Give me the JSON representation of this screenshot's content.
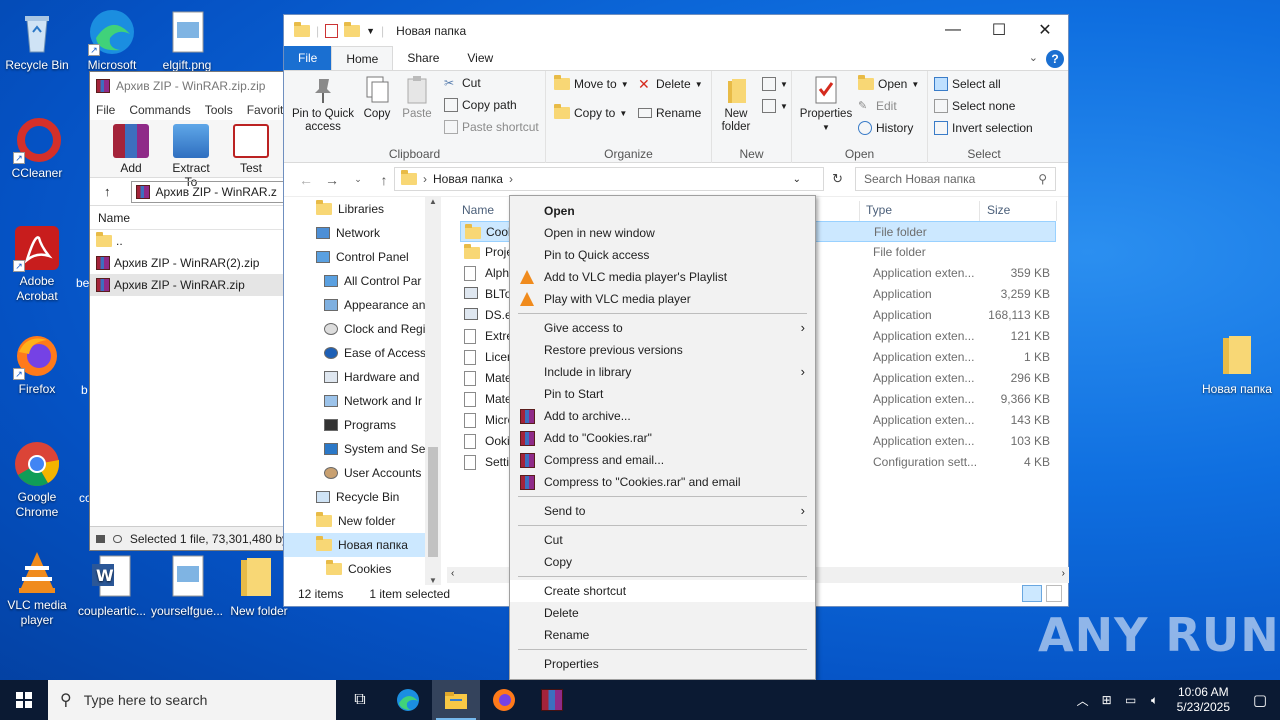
{
  "desktop": {
    "icons": [
      {
        "label": "Recycle Bin"
      },
      {
        "label": "Microsoft"
      },
      {
        "label": "elgift.png"
      },
      {
        "label": "CCleaner"
      },
      {
        "label": "Adobe Acrobat"
      },
      {
        "label": "Firefox"
      },
      {
        "label": "Google Chrome"
      },
      {
        "label": "VLC media player"
      },
      {
        "label": "coupleartic..."
      },
      {
        "label": "yourselfgue..."
      },
      {
        "label": "New folder"
      },
      {
        "label": "Новая папка"
      }
    ],
    "partial_labels": {
      "be": "be",
      "b": "b",
      "co": "co"
    }
  },
  "winrar": {
    "title": "Архив ZIP - WinRAR.zip.zip",
    "menu": [
      "File",
      "Commands",
      "Tools",
      "Favorite"
    ],
    "tools": [
      "Add",
      "Extract To",
      "Test"
    ],
    "path": "Архив ZIP - WinRAR.z",
    "column_name": "Name",
    "rows": [
      "..",
      "Архив ZIP - WinRAR(2).zip",
      "Архив ZIP - WinRAR.zip"
    ],
    "status": "Selected 1 file, 73,301,480 by"
  },
  "explorer": {
    "title": "Новая папка",
    "tabs": [
      "File",
      "Home",
      "Share",
      "View"
    ],
    "clipboard": {
      "pin": "Pin to Quick access",
      "copy": "Copy",
      "paste": "Paste",
      "cut": "Cut",
      "copy_path": "Copy path",
      "paste_shortcut": "Paste shortcut",
      "label": "Clipboard"
    },
    "organize": {
      "move_to": "Move to",
      "copy_to": "Copy to",
      "delete": "Delete",
      "rename": "Rename",
      "label": "Organize"
    },
    "new": {
      "new_folder": "New folder",
      "label": "New"
    },
    "open": {
      "properties": "Properties",
      "open": "Open",
      "edit": "Edit",
      "history": "History",
      "label": "Open"
    },
    "select": {
      "select_all": "Select all",
      "select_none": "Select none",
      "invert": "Invert selection",
      "label": "Select"
    },
    "address": "Новая папка",
    "search_placeholder": "Search Новая папка",
    "nav": [
      "Libraries",
      "Network",
      "Control Panel",
      "All Control Par",
      "Appearance an",
      "Clock and Regi",
      "Ease of Access",
      "Hardware and",
      "Network and Ir",
      "Programs",
      "System and Se",
      "User Accounts",
      "Recycle Bin",
      "New folder",
      "Новая папка",
      "Cookies"
    ],
    "columns": {
      "name": "Name",
      "type": "Type",
      "size": "Size"
    },
    "files": [
      {
        "name": "Cook",
        "date_frag": "M",
        "type": "File folder",
        "size": ""
      },
      {
        "name": "Proje",
        "date_frag": "M",
        "type": "File folder",
        "size": ""
      },
      {
        "name": "Alpha",
        "date_frag": "1",
        "type": "Application exten...",
        "size": "359 KB"
      },
      {
        "name": "BLTo",
        "date_frag": "",
        "type": "Application",
        "size": "3,259 KB"
      },
      {
        "name": "DS.ex",
        "date_frag": "",
        "type": "Application",
        "size": "168,113 KB"
      },
      {
        "name": "Extre",
        "date_frag": "",
        "type": "Application exten...",
        "size": "121 KB"
      },
      {
        "name": "Licen",
        "date_frag": "M",
        "type": "Application exten...",
        "size": "1 KB"
      },
      {
        "name": "Mate",
        "date_frag": "1",
        "type": "Application exten...",
        "size": "296 KB"
      },
      {
        "name": "Mate",
        "date_frag": "1",
        "type": "Application exten...",
        "size": "9,366 KB"
      },
      {
        "name": "Micro",
        "date_frag": "M",
        "type": "Application exten...",
        "size": "143 KB"
      },
      {
        "name": "Ookii",
        "date_frag": "M",
        "type": "Application exten...",
        "size": "103 KB"
      },
      {
        "name": "Settin",
        "date_frag": "",
        "type": "Configuration sett...",
        "size": "4 KB"
      }
    ],
    "status_items": "12 items",
    "status_selected": "1 item selected"
  },
  "context_menu": {
    "items": [
      "Open",
      "Open in new window",
      "Pin to Quick access",
      "Add to VLC media player's Playlist",
      "Play with VLC media player",
      "Give access to",
      "Restore previous versions",
      "Include in library",
      "Pin to Start",
      "Add to archive...",
      "Add to \"Cookies.rar\"",
      "Compress and email...",
      "Compress to \"Cookies.rar\" and email",
      "Send to",
      "Cut",
      "Copy",
      "Create shortcut",
      "Delete",
      "Rename",
      "Properties"
    ]
  },
  "taskbar": {
    "search_placeholder": "Type here to search",
    "time": "10:06 AM",
    "date": "5/23/2025"
  },
  "watermark": "ANY RUN",
  "colors": {
    "accent": "#1a6fd1",
    "selection": "#cce8ff",
    "taskbar": "#0b1a33"
  }
}
